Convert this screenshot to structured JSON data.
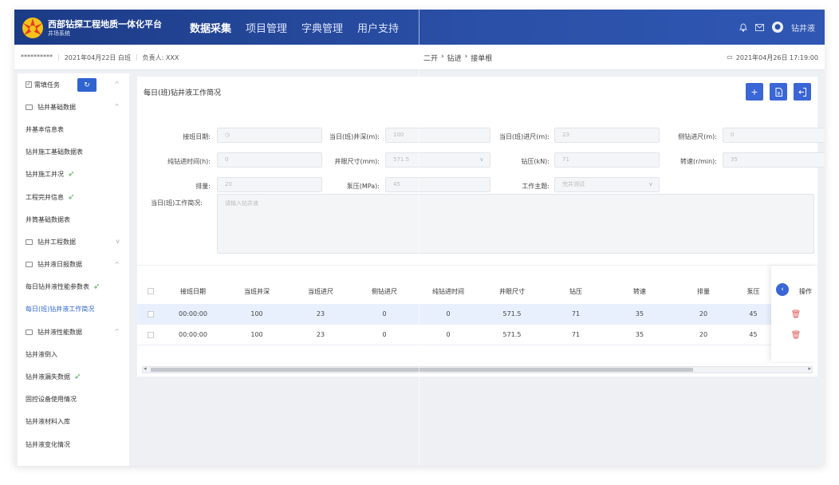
{
  "brand": {
    "title": "西部钻探工程地质一体化平台",
    "subtitle": "井场系统"
  },
  "nav": [
    {
      "label": "数据采集"
    },
    {
      "label": "项目管理"
    },
    {
      "label": "字典管理"
    },
    {
      "label": "用户支持"
    }
  ],
  "user": {
    "name": "钻井液"
  },
  "infobar": {
    "masked": "**********",
    "date": "2021年04月22日 白班",
    "owner": "负责人: XXX",
    "crumb1": "二开",
    "crumb2": "钻进",
    "crumb3": "接单根",
    "datetime": "2021年04月26日 17:19:00"
  },
  "sidebar": [
    {
      "label": "需填任务"
    },
    {
      "label": "钻井基础数据"
    },
    {
      "label": "井基本信息表"
    },
    {
      "label": "钻井施工基础数据表"
    },
    {
      "label": "钻井施工井况"
    },
    {
      "label": "工程完井信息"
    },
    {
      "label": "井筒基础数据表"
    },
    {
      "label": "钻井工程数据"
    },
    {
      "label": "钻井液日报数据"
    },
    {
      "label": "每日钻井液性能参数表"
    },
    {
      "label": "每日(班)钻井液工作简况"
    },
    {
      "label": "钻井液性能数据"
    },
    {
      "label": "钻井液倒入"
    },
    {
      "label": "钻井液漏失数据"
    },
    {
      "label": "固控设备使用情况"
    },
    {
      "label": "钻井液材料入库"
    },
    {
      "label": "钻井液变化情况"
    }
  ],
  "form": {
    "title": "每日(班)钻井液工作简况",
    "fields": {
      "receive_date": {
        "label": "接班日期:",
        "value": ""
      },
      "daily_depth": {
        "label": "当日(班)井深(m):",
        "value": "100"
      },
      "daily_footage": {
        "label": "当日(班)进尺(m):",
        "value": "23"
      },
      "sidetrack_footage": {
        "label": "侧钻进尺(m):",
        "value": "0"
      },
      "drill_time": {
        "label": "纯钻进时间(h):",
        "value": "0"
      },
      "hole_size": {
        "label": "井眼尺寸(mm):",
        "value": "571.5"
      },
      "wob": {
        "label": "钻压(kN):",
        "value": "71"
      },
      "rpm": {
        "label": "转速(r/min):",
        "value": "35"
      },
      "displacement": {
        "label": "排量:",
        "value": "20"
      },
      "pump_pressure": {
        "label": "泵压(MPa):",
        "value": "45"
      },
      "theme": {
        "label": "工作主题:",
        "value": "完井测试"
      },
      "work_summary": {
        "label": "当日(班)工作简况:",
        "placeholder": "请输入钻井液"
      }
    }
  },
  "table": {
    "headers": [
      "接班日期",
      "当班井深",
      "当班进尺",
      "侧钻进尺",
      "纯钻进时间",
      "井眼尺寸",
      "钻压",
      "转速",
      "排量",
      "泵压",
      "操作"
    ],
    "rows": [
      [
        "00:00:00",
        "100",
        "23",
        "0",
        "0",
        "571.5",
        "71",
        "35",
        "20",
        "45"
      ],
      [
        "00:00:00",
        "100",
        "23",
        "0",
        "0",
        "571.5",
        "71",
        "35",
        "20",
        "45"
      ]
    ]
  },
  "colors": {
    "primary": "#2f63d1",
    "header_bg": "#1c3b86",
    "leaf": "#4aa84a",
    "danger": "#e05a5a"
  }
}
